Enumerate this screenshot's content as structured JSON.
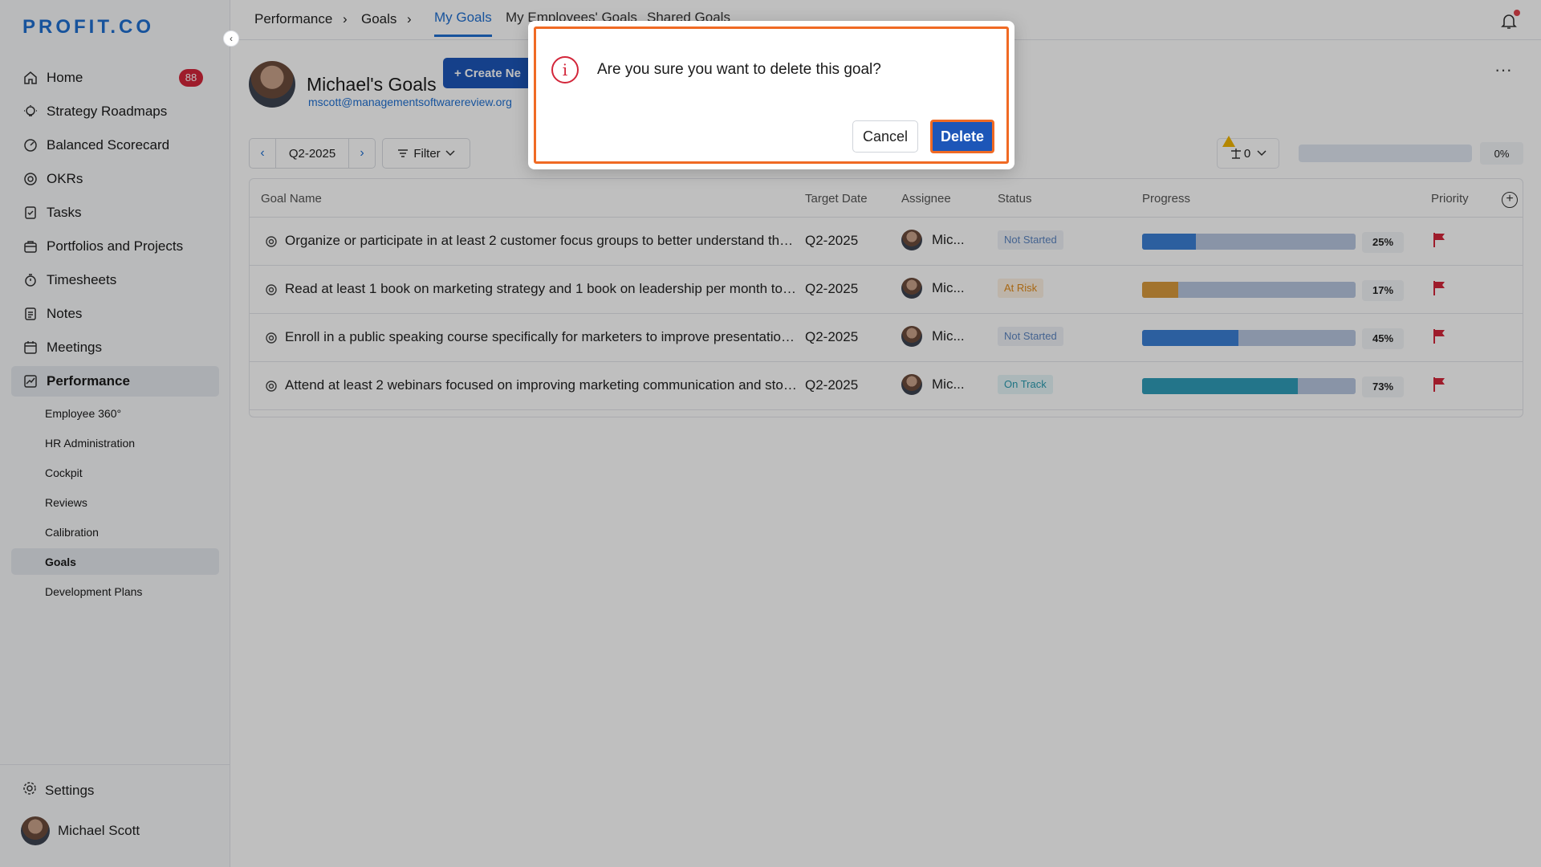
{
  "app": {
    "logo": "PROFIT.CO"
  },
  "sidebar": {
    "collapse_icon": "‹",
    "items": [
      {
        "label": "Home",
        "icon": "home-icon",
        "badge": "88"
      },
      {
        "label": "Strategy Roadmaps",
        "icon": "bulb-icon"
      },
      {
        "label": "Balanced Scorecard",
        "icon": "gauge-icon"
      },
      {
        "label": "OKRs",
        "icon": "target-icon"
      },
      {
        "label": "Tasks",
        "icon": "checklist-icon"
      },
      {
        "label": "Portfolios and Projects",
        "icon": "briefcase-icon"
      },
      {
        "label": "Timesheets",
        "icon": "stopwatch-icon"
      },
      {
        "label": "Notes",
        "icon": "notes-icon"
      },
      {
        "label": "Meetings",
        "icon": "calendar-icon"
      },
      {
        "label": "Performance",
        "icon": "chart-icon",
        "active": true
      }
    ],
    "sub_items": [
      {
        "label": "Employee 360°"
      },
      {
        "label": "HR Administration"
      },
      {
        "label": "Cockpit"
      },
      {
        "label": "Reviews"
      },
      {
        "label": "Calibration"
      },
      {
        "label": "Goals",
        "active": true
      },
      {
        "label": "Development Plans"
      }
    ],
    "settings_label": "Settings",
    "user_name": "Michael Scott"
  },
  "topbar": {
    "breadcrumb": [
      "Performance",
      "Goals"
    ],
    "separator": "›",
    "tabs": [
      "My Goals",
      "My Employees' Goals",
      "Shared Goals"
    ],
    "active_tab": "My Goals"
  },
  "header": {
    "title": "Michael's Goals",
    "create_label": "+ Create Ne",
    "email": "mscott@managementsoftwarereview.org",
    "more": "···"
  },
  "toolbar": {
    "period": "Q2-2025",
    "prev": "‹",
    "next": "›",
    "filter_label": "Filter",
    "weight_value": "0",
    "overall_progress": "0%"
  },
  "table": {
    "columns": [
      "Goal Name",
      "Target Date",
      "Assignee",
      "Status",
      "Progress",
      "Priority"
    ],
    "add_column": "+",
    "rows": [
      {
        "name": "Organize or participate in at least 2 customer focus groups to better understand the t...",
        "date": "Q2-2025",
        "assignee": "Mic...",
        "status": "Not Started",
        "progress": 25,
        "progress_label": "25%",
        "bar_color": "#3b7fd4"
      },
      {
        "name": "Read at least 1 book on marketing strategy and 1 book on leadership per month to im...",
        "date": "Q2-2025",
        "assignee": "Mic...",
        "status": "At Risk",
        "progress": 17,
        "progress_label": "17%",
        "bar_color": "#d99a3c"
      },
      {
        "name": "Enroll in a public speaking course specifically for marketers to improve presentation a...",
        "date": "Q2-2025",
        "assignee": "Mic...",
        "status": "Not Started",
        "progress": 45,
        "progress_label": "45%",
        "bar_color": "#3b7fd4"
      },
      {
        "name": "Attend at least 2 webinars focused on improving marketing communication and storyt...",
        "date": "Q2-2025",
        "assignee": "Mic...",
        "status": "On Track",
        "progress": 73,
        "progress_label": "73%",
        "bar_color": "#2f9cb8"
      }
    ]
  },
  "modal": {
    "icon": "i",
    "message": "Are you sure you want to delete this goal?",
    "cancel_label": "Cancel",
    "delete_label": "Delete"
  },
  "colors": {
    "accent": "#1f6fd1",
    "primary_button": "#1d56b8",
    "danger": "#d3263a",
    "highlight": "#f06a24"
  }
}
